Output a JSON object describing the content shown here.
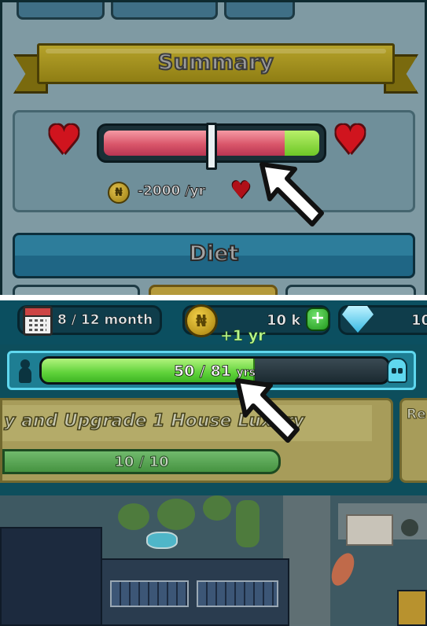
{
  "summary": {
    "title": "Summary",
    "health_fraction": 0.84,
    "cost_text": "-2000 /yr",
    "coin_symbol": "₦"
  },
  "diet": {
    "label": "Diet"
  },
  "hud": {
    "month_text": "8 / 12 month",
    "money_text": "10 k",
    "plus_symbol": "+",
    "gem_text": "10",
    "coin_symbol": "₦"
  },
  "life": {
    "increment_text": "+1 yr",
    "current_age": "50",
    "separator": " / ",
    "max_age": "81",
    "unit": "yrs",
    "progress_fraction": 0.617
  },
  "quest": {
    "title": "y and Upgrade 1 House Luxury",
    "progress_text": "10 / 10",
    "side_label": "Re"
  },
  "colors": {
    "health_red": "#d9566a",
    "health_green": "#6dc726",
    "life_green": "#5fd23a",
    "panel_teal": "#1e7e93",
    "accent_cyan": "#5fd7ee"
  }
}
